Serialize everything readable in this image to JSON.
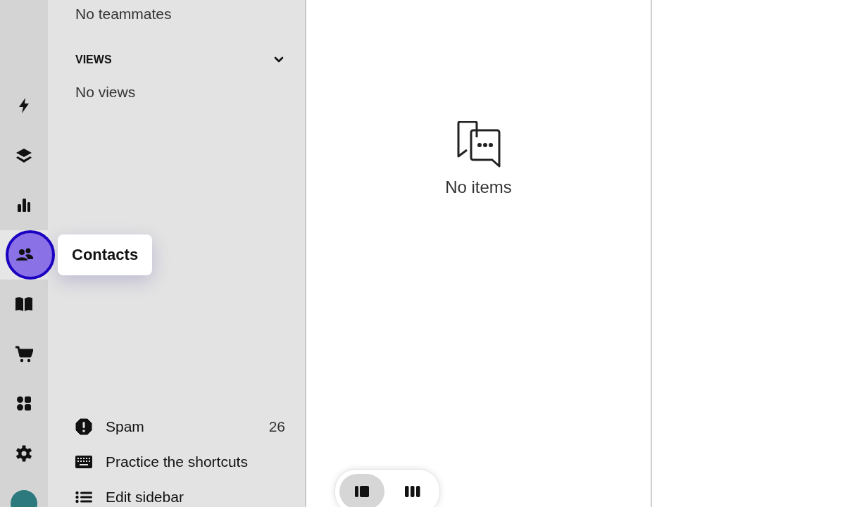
{
  "rail": [
    {
      "kind": "bolt",
      "selected": false
    },
    {
      "kind": "layers",
      "selected": false
    },
    {
      "kind": "chart",
      "selected": false
    },
    {
      "kind": "people",
      "selected": true,
      "tooltip": "Contacts"
    },
    {
      "kind": "book",
      "selected": false
    },
    {
      "kind": "cart",
      "selected": false
    },
    {
      "kind": "apps",
      "selected": false
    },
    {
      "kind": "gear",
      "selected": false
    }
  ],
  "sidebar": {
    "teammates_empty": "No teammates",
    "views_heading": "VIEWS",
    "views_expanded": true,
    "views_empty": "No views",
    "footer_items": [
      {
        "kind": "spam",
        "label": "Spam",
        "count": "26"
      },
      {
        "kind": "keyboard",
        "label": "Practice the shortcuts"
      },
      {
        "kind": "list",
        "label": "Edit sidebar"
      }
    ]
  },
  "content": {
    "empty_text": "No items"
  },
  "view_toggle": [
    {
      "kind": "split",
      "selected": true
    },
    {
      "kind": "columns",
      "selected": false
    }
  ]
}
